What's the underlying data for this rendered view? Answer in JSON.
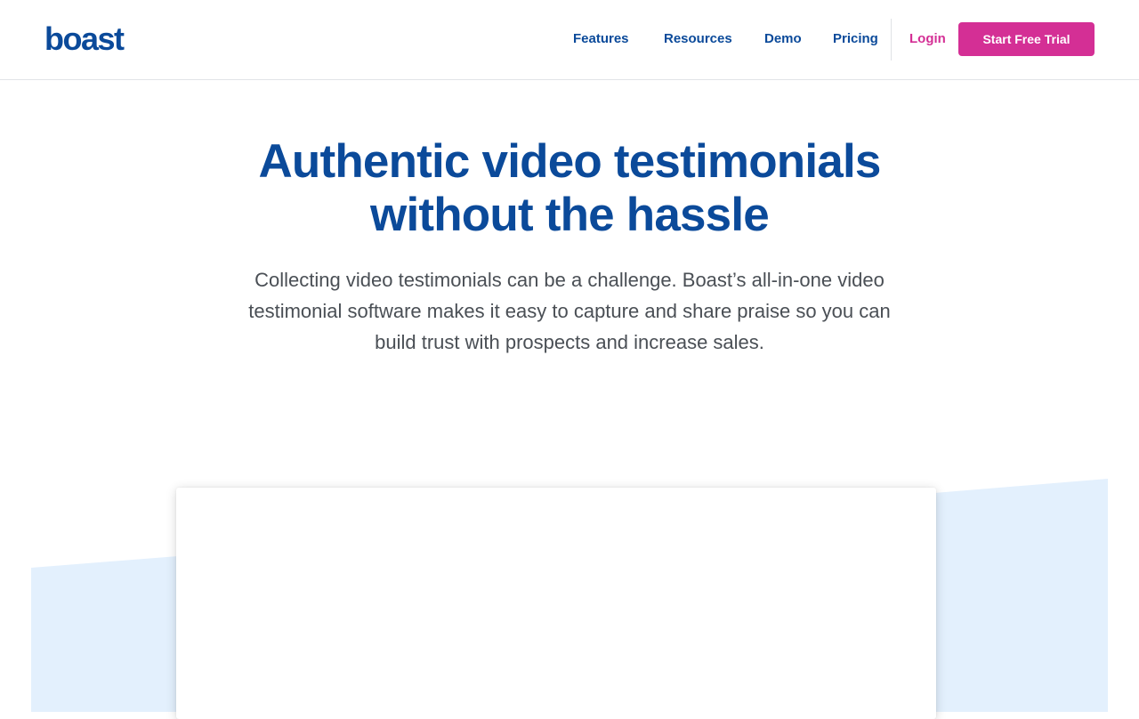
{
  "brand": {
    "logo_text": "boast",
    "primary_color": "#0b4a9a",
    "accent_color": "#d42f95",
    "panel_color": "#e3f0fd"
  },
  "nav": {
    "items": [
      {
        "label": "Features"
      },
      {
        "label": "Resources"
      },
      {
        "label": "Demo"
      },
      {
        "label": "Pricing"
      }
    ],
    "login_label": "Login",
    "cta_label": "Start Free Trial"
  },
  "hero": {
    "title_line1": "Authentic video testimonials",
    "title_line2": "without the hassle",
    "subtitle": "Collecting video testimonials can be a challenge. Boast’s all-in-one video testimonial software makes it easy to capture and share praise so you can build trust with prospects and increase sales."
  }
}
